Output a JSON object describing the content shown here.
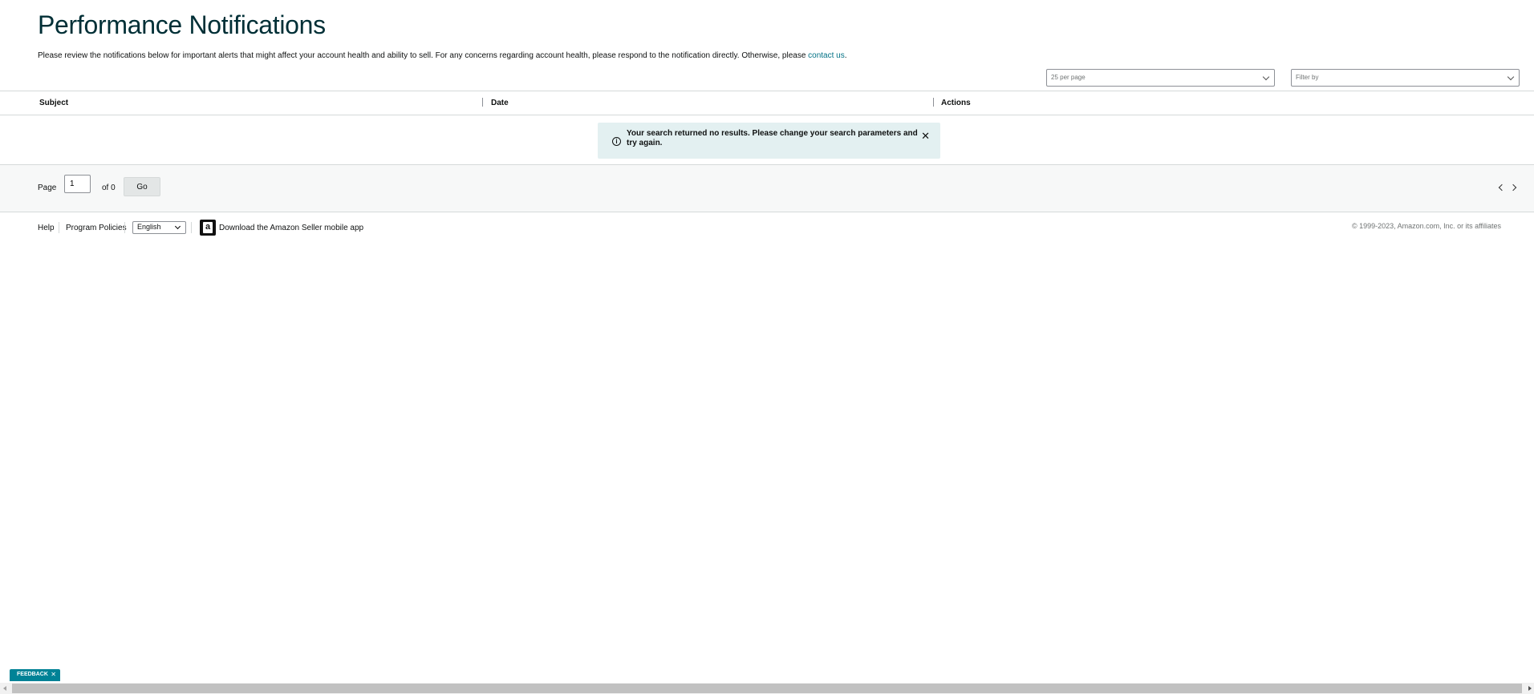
{
  "header": {
    "title": "Performance Notifications",
    "description": "Please review the notifications below for important alerts that might affect your account health and ability to sell. For any concerns regarding account health, please respond to the notification directly. Otherwise, please ",
    "contact_link": "contact us",
    "description_end": "."
  },
  "controls": {
    "per_page": "25 per page",
    "filter_placeholder": "Filter by"
  },
  "table": {
    "columns": [
      "Subject",
      "Date",
      "Actions"
    ]
  },
  "alert": {
    "message": "Your search returned no results. Please change your search parameters and try again.",
    "icon": "info-icon",
    "close": "✕"
  },
  "pager": {
    "page_label": "Page",
    "page_value": "1",
    "of_label": "of 0",
    "go_label": "Go"
  },
  "footer": {
    "help": "Help",
    "program_policies": "Program Policies",
    "language": "English",
    "app_link": "Download the Amazon Seller mobile app",
    "copyright": "© 1999-2023, Amazon.com, Inc. or its affiliates"
  },
  "feedback": {
    "label": "FEEDBACK",
    "close": "✕"
  },
  "colors": {
    "title": "#002f36",
    "link": "#007185",
    "alert_bg": "#e3f0f1",
    "feedback_bg": "#008296"
  }
}
